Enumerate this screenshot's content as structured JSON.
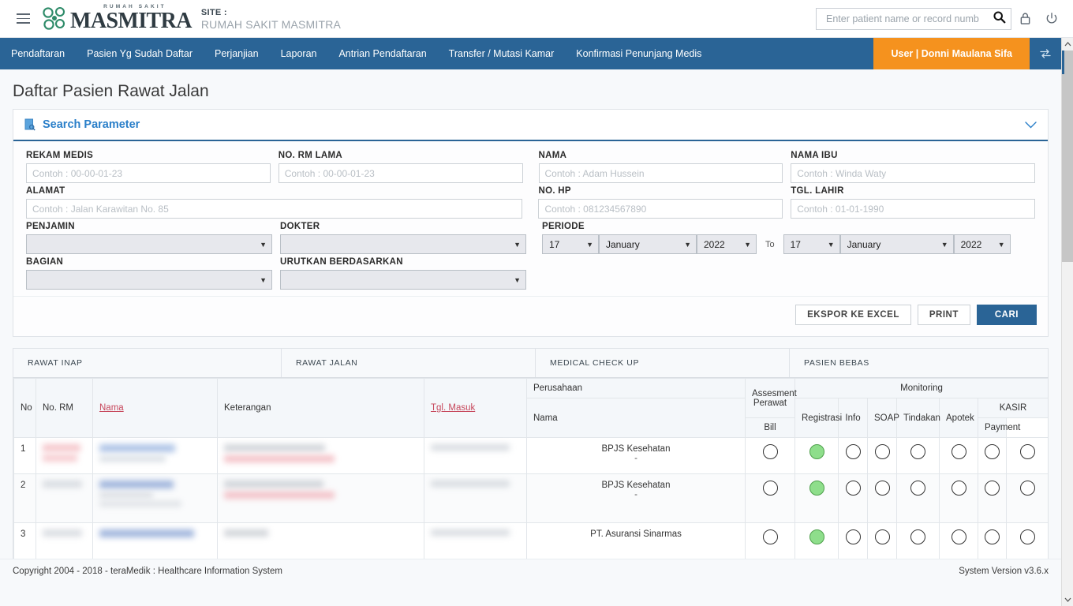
{
  "brand": {
    "logo_top": "RUMAH SAKIT",
    "logo_name": "MASMITRA",
    "site_label": "SITE :",
    "site_name": "RUMAH SAKIT MASMITRA"
  },
  "header": {
    "search_placeholder": "Enter patient name or record numb",
    "search_value": "",
    "icons": {
      "menu": "hamburger-icon",
      "search": "search-icon",
      "lock": "lock-icon",
      "power": "power-icon"
    }
  },
  "nav": {
    "items": [
      "Pendaftaran",
      "Pasien Yg Sudah Daftar",
      "Perjanjian",
      "Laporan",
      "Antrian Pendaftaran",
      "Transfer / Mutasi Kamar",
      "Konfirmasi Penunjang Medis"
    ],
    "user_badge": "User | Donni Maulana Sifa",
    "swap_icon": "swap-icon"
  },
  "page": {
    "title": "Daftar Pasien Rawat Jalan"
  },
  "search_panel": {
    "title": "Search Parameter",
    "icon": "search-document-icon",
    "collapse_icon": "chevron-down-icon",
    "fields": [
      {
        "label": "REKAM MEDIS",
        "placeholder": "Contoh : 00-00-01-23",
        "value": ""
      },
      {
        "label": "NO. RM LAMA",
        "placeholder": "Contoh : 00-00-01-23",
        "value": ""
      },
      {
        "label": "NAMA",
        "placeholder": "Contoh : Adam Hussein",
        "value": ""
      },
      {
        "label": "NAMA IBU",
        "placeholder": "Contoh : Winda Waty",
        "value": ""
      },
      {
        "label": "ALAMAT",
        "placeholder": "Contoh : Jalan Karawitan No. 85",
        "value": ""
      },
      {
        "label": "NO. HP",
        "placeholder": "Contoh : 081234567890",
        "value": ""
      },
      {
        "label": "TGL. LAHIR",
        "placeholder": "Contoh : 01-01-1990",
        "value": ""
      }
    ],
    "selects": [
      {
        "label": "PENJAMIN",
        "value": ""
      },
      {
        "label": "DOKTER",
        "value": ""
      },
      {
        "label": "BAGIAN",
        "value": ""
      },
      {
        "label": "URUTKAN BERDASARKAN",
        "value": ""
      }
    ],
    "periode": {
      "label": "PERIODE",
      "to_label": "To",
      "from": {
        "day": "17",
        "month": "January",
        "year": "2022"
      },
      "until": {
        "day": "17",
        "month": "January",
        "year": "2022"
      }
    },
    "buttons": {
      "export": "EKSPOR KE EXCEL",
      "print": "PRINT",
      "search": "CARI"
    }
  },
  "tabs": [
    {
      "label": "RAWAT INAP"
    },
    {
      "label": "RAWAT JALAN"
    },
    {
      "label": "MEDICAL CHECK UP"
    },
    {
      "label": "PASIEN BEBAS"
    }
  ],
  "table": {
    "headers": {
      "no": "No",
      "no_rm": "No. RM",
      "nama": "Nama",
      "keterangan": "Keterangan",
      "tgl_masuk": "Tgl. Masuk",
      "perusahaan": "Perusahaan",
      "perusahaan_nama": "Nama",
      "assesment_perawat": "Assesment Perawat",
      "monitoring": "Monitoring",
      "registrasi": "Registrasi",
      "info": "Info",
      "soap": "SOAP",
      "tindakan": "Tindakan",
      "apotek": "Apotek",
      "kasir": "KASIR",
      "bill": "Bill",
      "payment": "Payment"
    },
    "rows": [
      {
        "no": "1",
        "perusahaan": "BPJS Kesehatan",
        "perusahaan_sub": "-",
        "redacted": true,
        "status": {
          "assesment": "off",
          "registrasi": "on",
          "info": "off",
          "soap": "off",
          "tindakan": "off",
          "apotek": "off",
          "bill": "off",
          "payment": "off"
        }
      },
      {
        "no": "2",
        "perusahaan": "BPJS Kesehatan",
        "perusahaan_sub": "-",
        "redacted": true,
        "status": {
          "assesment": "off",
          "registrasi": "on",
          "info": "off",
          "soap": "off",
          "tindakan": "off",
          "apotek": "off",
          "bill": "off",
          "payment": "off"
        }
      },
      {
        "no": "3",
        "perusahaan": "PT. Asuransi Sinarmas",
        "perusahaan_sub": "",
        "redacted": true,
        "status": {
          "assesment": "off",
          "registrasi": "on",
          "info": "off",
          "soap": "off",
          "tindakan": "off",
          "apotek": "off",
          "bill": "off",
          "payment": "off"
        }
      }
    ]
  },
  "footer": {
    "copyright": "Copyright 2004 - 2018 - teraMedik : Healthcare Information System",
    "version": "System Version v3.6.x"
  },
  "colors": {
    "nav_blue": "#2a6496",
    "accent_orange": "#f5921e",
    "link_blue": "#2a7fc9",
    "status_green": "#8ede8b",
    "sort_link_red": "#c7485c",
    "logo_green": "#2e8b69"
  }
}
